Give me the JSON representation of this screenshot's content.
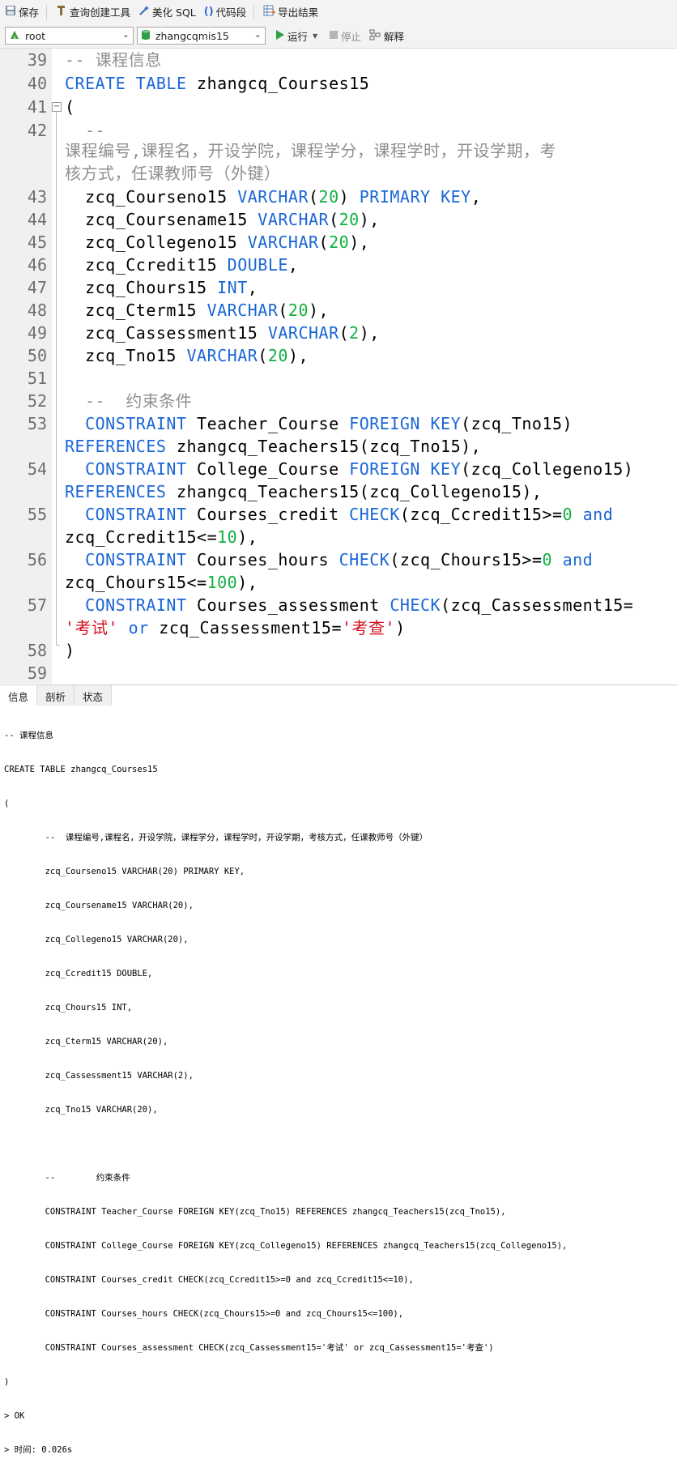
{
  "toolbar": {
    "save_label": "保存",
    "query_builder_label": "查询创建工具",
    "beautify_label": "美化 SQL",
    "snippet_label": "代码段",
    "export_label": "导出结果"
  },
  "connection_bar": {
    "connection_value": "root",
    "database_value": "zhangcqmis15",
    "run_label": "运行",
    "stop_label": "停止",
    "explain_label": "解释"
  },
  "editor": {
    "line_numbers": [
      "39",
      "40",
      "41",
      "42",
      "43",
      "44",
      "45",
      "46",
      "47",
      "48",
      "49",
      "50",
      "51",
      "52",
      "53",
      "54",
      "55",
      "56",
      "57",
      "58",
      "59"
    ],
    "lines": [
      "-- 课程信息",
      "CREATE TABLE zhangcq_Courses15",
      "(",
      "  --",
      "课程编号,课程名，开设学院，课程学分，课程学时，开设学期，考",
      "核方式，任课教师号（外键）",
      "  zcq_Courseno15 VARCHAR(20) PRIMARY KEY,",
      "  zcq_Coursename15 VARCHAR(20),",
      "  zcq_Collegeno15 VARCHAR(20),",
      "  zcq_Ccredit15 DOUBLE,",
      "  zcq_Chours15 INT,",
      "  zcq_Cterm15 VARCHAR(20),",
      "  zcq_Cassessment15 VARCHAR(2),",
      "  zcq_Tno15 VARCHAR(20),",
      "",
      "  --  约束条件",
      "  CONSTRAINT Teacher_Course FOREIGN KEY(zcq_Tno15)",
      "REFERENCES zhangcq_Teachers15(zcq_Tno15),",
      "  CONSTRAINT College_Course FOREIGN KEY(zcq_Collegeno15)",
      "REFERENCES zhangcq_Teachers15(zcq_Collegeno15),",
      "  CONSTRAINT Courses_credit CHECK(zcq_Ccredit15>=0 and",
      "zcq_Ccredit15<=10),",
      "  CONSTRAINT Courses_hours CHECK(zcq_Chours15>=0 and",
      "zcq_Chours15<=100),",
      "  CONSTRAINT Courses_assessment CHECK(zcq_Cassessment15=",
      "'考试' or zcq_Cassessment15='考查')",
      ")",
      ""
    ]
  },
  "result_tabs": [
    "信息",
    "剖析",
    "状态"
  ],
  "output_lines": [
    "-- 课程信息",
    "CREATE TABLE zhangcq_Courses15",
    "(",
    "\t--  课程编号,课程名，开设学院，课程学分，课程学时，开设学期，考核方式，任课教师号（外键）",
    "\tzcq_Courseno15 VARCHAR(20) PRIMARY KEY,",
    "\tzcq_Coursename15 VARCHAR(20),",
    "\tzcq_Collegeno15 VARCHAR(20),",
    "\tzcq_Ccredit15 DOUBLE,",
    "\tzcq_Chours15 INT,",
    "\tzcq_Cterm15 VARCHAR(20),",
    "\tzcq_Cassessment15 VARCHAR(2),",
    "\tzcq_Tno15 VARCHAR(20),",
    "",
    "\t--\t约束条件",
    "\tCONSTRAINT Teacher_Course FOREIGN KEY(zcq_Tno15) REFERENCES zhangcq_Teachers15(zcq_Tno15),",
    "\tCONSTRAINT College_Course FOREIGN KEY(zcq_Collegeno15) REFERENCES zhangcq_Teachers15(zcq_Collegeno15),",
    "\tCONSTRAINT Courses_credit CHECK(zcq_Ccredit15>=0 and zcq_Ccredit15<=10),",
    "\tCONSTRAINT Courses_hours CHECK(zcq_Chours15>=0 and zcq_Chours15<=100),",
    "\tCONSTRAINT Courses_assessment CHECK(zcq_Cassessment15='考试' or zcq_Cassessment15='考查')",
    ")",
    "> OK",
    "> 时间: 0.026s"
  ],
  "colors": {
    "keyword": "#1a66d6",
    "number": "#10b040",
    "comment": "#8f8f8f",
    "string": "#d1121e",
    "run_icon": "#2ea043"
  }
}
